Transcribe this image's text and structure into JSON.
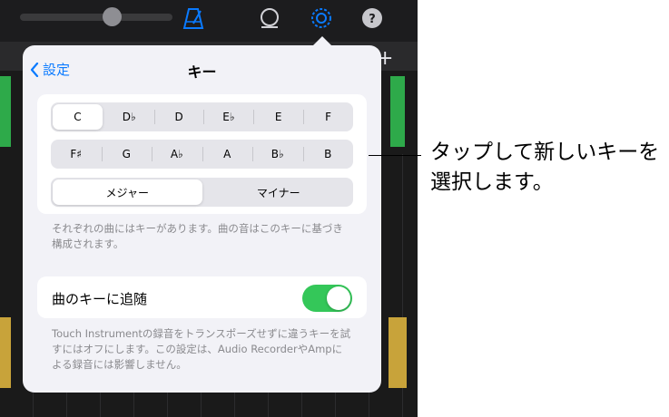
{
  "popover": {
    "back_label": "設定",
    "title": "キー",
    "keys_row1": [
      "C",
      "D♭",
      "D",
      "E♭",
      "E",
      "F"
    ],
    "keys_row2": [
      "F♯",
      "G",
      "A♭",
      "A",
      "B♭",
      "B"
    ],
    "selected_key": "C",
    "scale_options": [
      "メジャー",
      "マイナー"
    ],
    "selected_scale": "メジャー",
    "key_description": "それぞれの曲にはキーがあります。曲の音はこのキーに基づき構成されます。",
    "follow_song_key_label": "曲のキーに追随",
    "follow_song_key_on": true,
    "follow_description": "Touch Instrumentの録音をトランスポーズせずに違うキーを試すにはオフにします。この設定は、Audio RecorderやAmpによる録音には影響しません。"
  },
  "toolbar": {
    "icons": [
      "metronome-icon",
      "loop-icon",
      "settings-icon",
      "help-icon"
    ],
    "help_label": "?"
  },
  "callout": {
    "text": "タップして新しいキーを選択します。"
  },
  "colors": {
    "accent": "#0a7aff",
    "toggle_on": "#34c759"
  }
}
